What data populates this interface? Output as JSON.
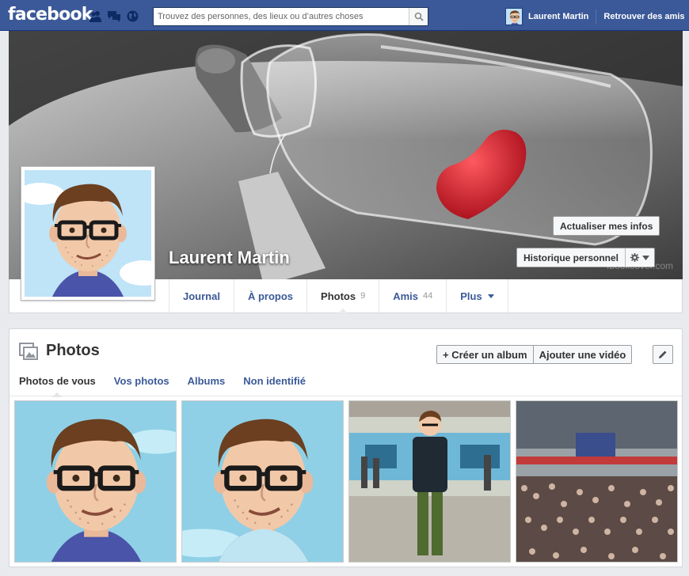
{
  "topbar": {
    "logo": "facebook",
    "search_placeholder": "Trouvez des personnes, des lieux ou d’autres choses",
    "user_name": "Laurent Martin",
    "find_friends": "Retrouver des amis",
    "jewels": [
      "friend-requests-icon",
      "messages-icon",
      "notifications-globe-icon"
    ]
  },
  "cover": {
    "name": "Laurent Martin",
    "update_button": "Actualiser mes infos",
    "history_button": "Historique personnel",
    "watermark": "fbookcover.com"
  },
  "profile_tabs": [
    {
      "label": "Journal",
      "count": ""
    },
    {
      "label": "À propos",
      "count": ""
    },
    {
      "label": "Photos",
      "count": "9"
    },
    {
      "label": "Amis",
      "count": "44"
    },
    {
      "label": "Plus",
      "count": ""
    }
  ],
  "photos": {
    "title": "Photos",
    "create_album": "+ Créer un album",
    "add_video": "Ajouter une vidéo",
    "subtabs": [
      "Photos de vous",
      "Vos photos",
      "Albums",
      "Non identifié"
    ]
  },
  "colors": {
    "brand": "#3b5998",
    "page_bg": "#e9eaed",
    "heart": "#d8202c"
  }
}
